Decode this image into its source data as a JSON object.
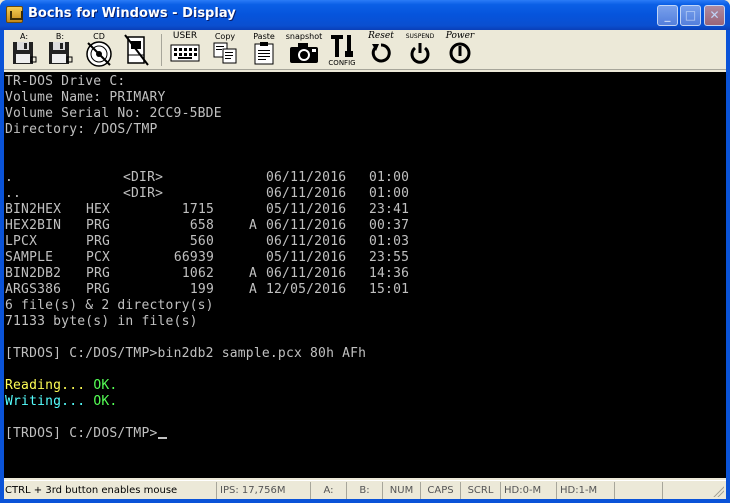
{
  "window": {
    "title": "Bochs for Windows - Display",
    "minimize_glyph": "_",
    "maximize_glyph": "□",
    "close_glyph": "✕"
  },
  "toolbar": {
    "floppy_a": "A:",
    "floppy_b": "B:",
    "cdrom": "CD",
    "user": "USER",
    "copy": "Copy",
    "paste": "Paste",
    "snapshot": "snapshot",
    "config": "CONFIG",
    "reset": "Reset",
    "suspend": "SUSPEND",
    "power": "Power"
  },
  "terminal": {
    "header": [
      "TR-DOS Drive C:",
      "Volume Name: PRIMARY",
      "Volume Serial No: 2CC9-5BDE",
      "Directory: /DOS/TMP"
    ],
    "entries": [
      {
        "name": ".",
        "ext": "",
        "dir": "<DIR>",
        "size": "",
        "attr": "",
        "date": "06/11/2016",
        "time": "01:00"
      },
      {
        "name": "..",
        "ext": "",
        "dir": "<DIR>",
        "size": "",
        "attr": "",
        "date": "06/11/2016",
        "time": "01:00"
      },
      {
        "name": "BIN2HEX",
        "ext": "HEX",
        "dir": "",
        "size": "1715",
        "attr": "",
        "date": "05/11/2016",
        "time": "23:41"
      },
      {
        "name": "HEX2BIN",
        "ext": "PRG",
        "dir": "",
        "size": "658",
        "attr": "A",
        "date": "06/11/2016",
        "time": "00:37"
      },
      {
        "name": "LPCX",
        "ext": "PRG",
        "dir": "",
        "size": "560",
        "attr": "",
        "date": "06/11/2016",
        "time": "01:03"
      },
      {
        "name": "SAMPLE",
        "ext": "PCX",
        "dir": "",
        "size": "66939",
        "attr": "",
        "date": "05/11/2016",
        "time": "23:55"
      },
      {
        "name": "BIN2DB2",
        "ext": "PRG",
        "dir": "",
        "size": "1062",
        "attr": "A",
        "date": "06/11/2016",
        "time": "14:36"
      },
      {
        "name": "ARGS386",
        "ext": "PRG",
        "dir": "",
        "size": "199",
        "attr": "A",
        "date": "12/05/2016",
        "time": "15:01"
      }
    ],
    "summary_files": "6 file(s) & 2 directory(s)",
    "summary_bytes": "71133 byte(s) in file(s)",
    "prompt1": "[TRDOS] C:/DOS/TMP>",
    "command1": "bin2db2 sample.pcx 80h AFh",
    "reading_label": "Reading...",
    "writing_label": "Writing...",
    "ok": "OK.",
    "prompt2": "[TRDOS] C:/DOS/TMP>"
  },
  "status": {
    "mouse_hint": "CTRL + 3rd button enables mouse",
    "ips": "IPS: 17,756M",
    "a": "A:",
    "b": "B:",
    "num": "NUM",
    "caps": "CAPS",
    "scrl": "SCRL",
    "hd0": "HD:0-M",
    "hd1": "HD:1-M"
  }
}
